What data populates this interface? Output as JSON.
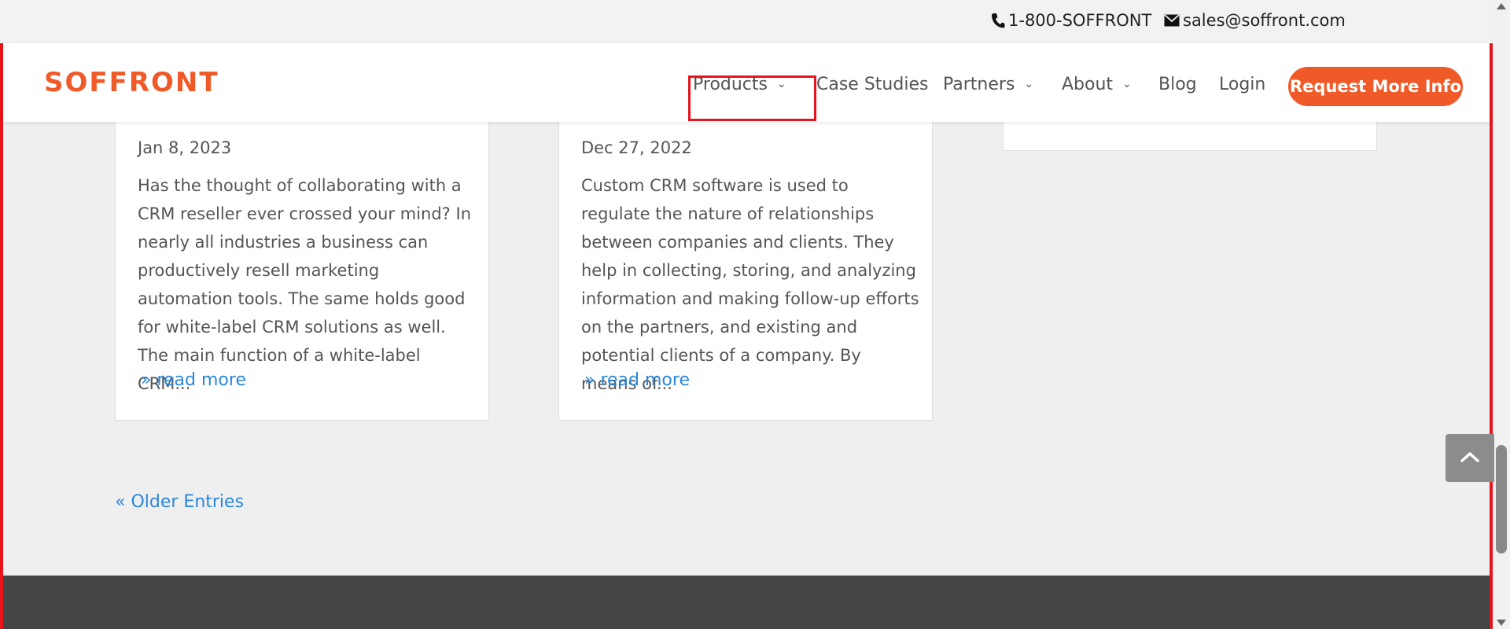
{
  "topbar": {
    "phone": "1-800-SOFFRONT",
    "email": "sales@soffront.com"
  },
  "header": {
    "logo": "SOFFRONT",
    "nav": {
      "products": "Products",
      "case_studies": "Case Studies",
      "partners": "Partners",
      "about": "About",
      "blog": "Blog",
      "login": "Login"
    },
    "cta": "Request More Info"
  },
  "posts": [
    {
      "date": "Jan 8, 2023",
      "excerpt": "Has the thought of collaborating with a CRM reseller ever crossed your mind? In nearly all industries a business can productively resell marketing automation tools. The same holds good for white-label CRM solutions as well. The main function of a white-label CRM...",
      "read_more": "» read more"
    },
    {
      "date": "Dec 27, 2022",
      "excerpt": "Custom CRM software is used to regulate the nature of relationships between companies and clients. They help in collecting, storing, and analyzing information and making follow-up efforts on the partners, and existing and potential clients of a company. By means of...",
      "read_more": "» read more"
    }
  ],
  "pagination": {
    "older": "« Older Entries"
  },
  "colors": {
    "brand": "#f05a28",
    "link": "#2b87da",
    "highlight": "#e8141c",
    "footer": "#444444"
  },
  "icons": [
    "phone-icon",
    "mail-icon",
    "chevron-down-icon",
    "chevron-up-icon"
  ]
}
